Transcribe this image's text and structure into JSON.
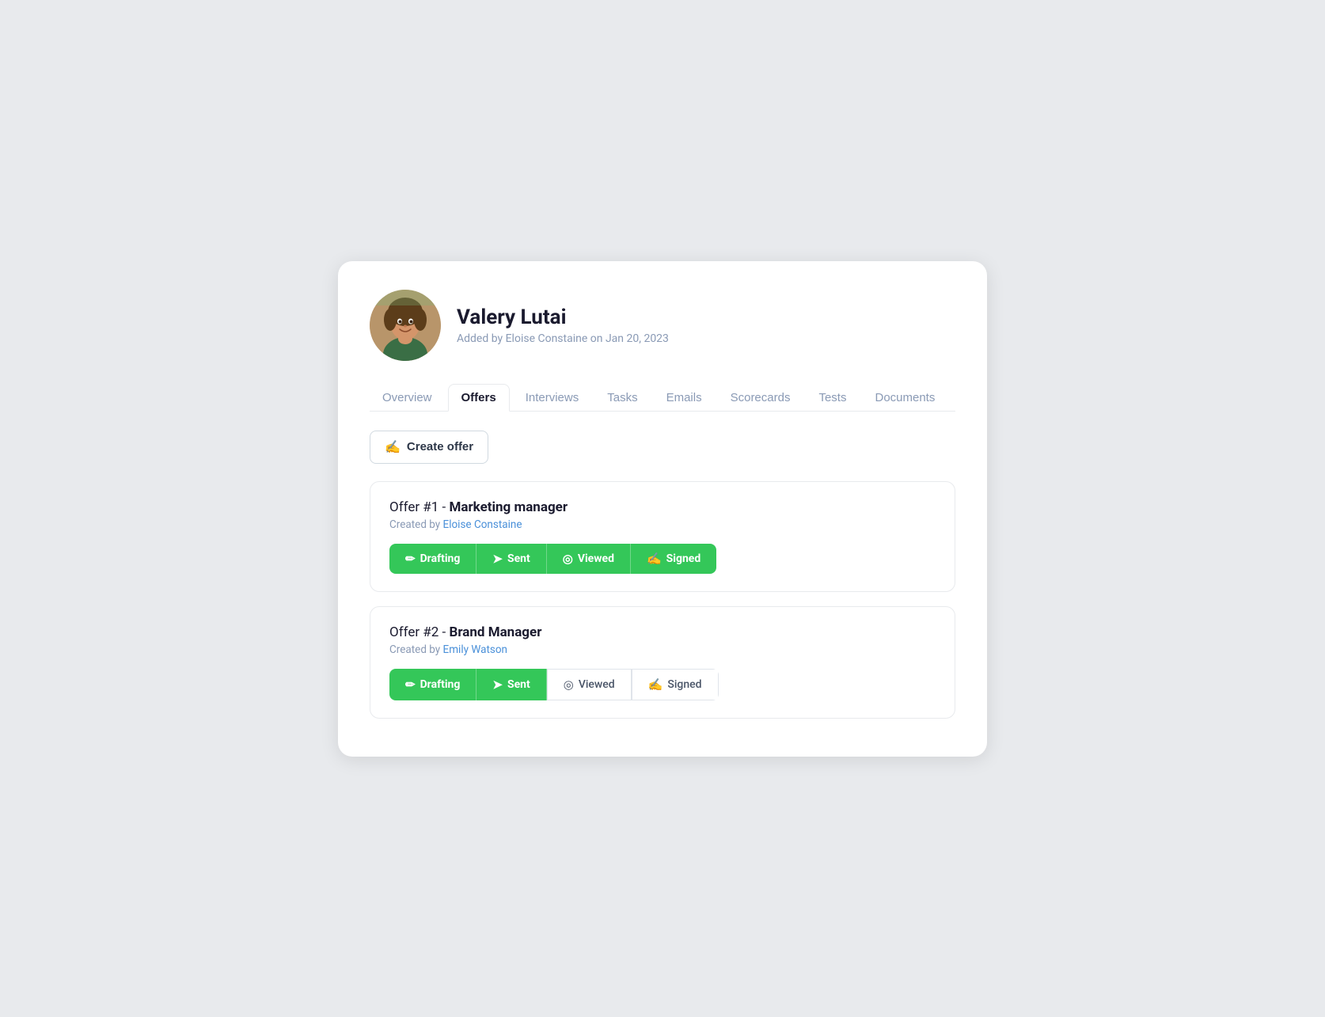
{
  "profile": {
    "name": "Valery Lutai",
    "subtitle": "Added by Eloise Constaine on Jan 20, 2023"
  },
  "tabs": [
    {
      "id": "overview",
      "label": "Overview",
      "active": false
    },
    {
      "id": "offers",
      "label": "Offers",
      "active": true
    },
    {
      "id": "interviews",
      "label": "Interviews",
      "active": false
    },
    {
      "id": "tasks",
      "label": "Tasks",
      "active": false
    },
    {
      "id": "emails",
      "label": "Emails",
      "active": false
    },
    {
      "id": "scorecards",
      "label": "Scorecards",
      "active": false
    },
    {
      "id": "tests",
      "label": "Tests",
      "active": false
    },
    {
      "id": "documents",
      "label": "Documents",
      "active": false
    }
  ],
  "create_offer_button": "Create offer",
  "offers": [
    {
      "id": 1,
      "title_prefix": "Offer #1 - ",
      "title_bold": "Marketing manager",
      "creator_prefix": "Created by ",
      "creator_name": "Eloise Constaine",
      "steps": [
        {
          "label": "Drafting",
          "icon": "✏️",
          "active": true
        },
        {
          "label": "Sent",
          "icon": "➤",
          "active": true
        },
        {
          "label": "Viewed",
          "icon": "◎",
          "active": true
        },
        {
          "label": "Signed",
          "icon": "✍",
          "active": true
        }
      ]
    },
    {
      "id": 2,
      "title_prefix": "Offer #2 - ",
      "title_bold": "Brand Manager",
      "creator_prefix": "Created by ",
      "creator_name": "Emily Watson",
      "steps": [
        {
          "label": "Drafting",
          "icon": "✏️",
          "active": true
        },
        {
          "label": "Sent",
          "icon": "➤",
          "active": true
        },
        {
          "label": "Viewed",
          "icon": "◎",
          "active": false
        },
        {
          "label": "Signed",
          "icon": "✍",
          "active": false
        }
      ]
    }
  ],
  "colors": {
    "active_tab_text": "#1a1a2e",
    "inactive_tab_text": "#8a9ab5",
    "green": "#34c759",
    "creator_link": "#4a90d9"
  }
}
